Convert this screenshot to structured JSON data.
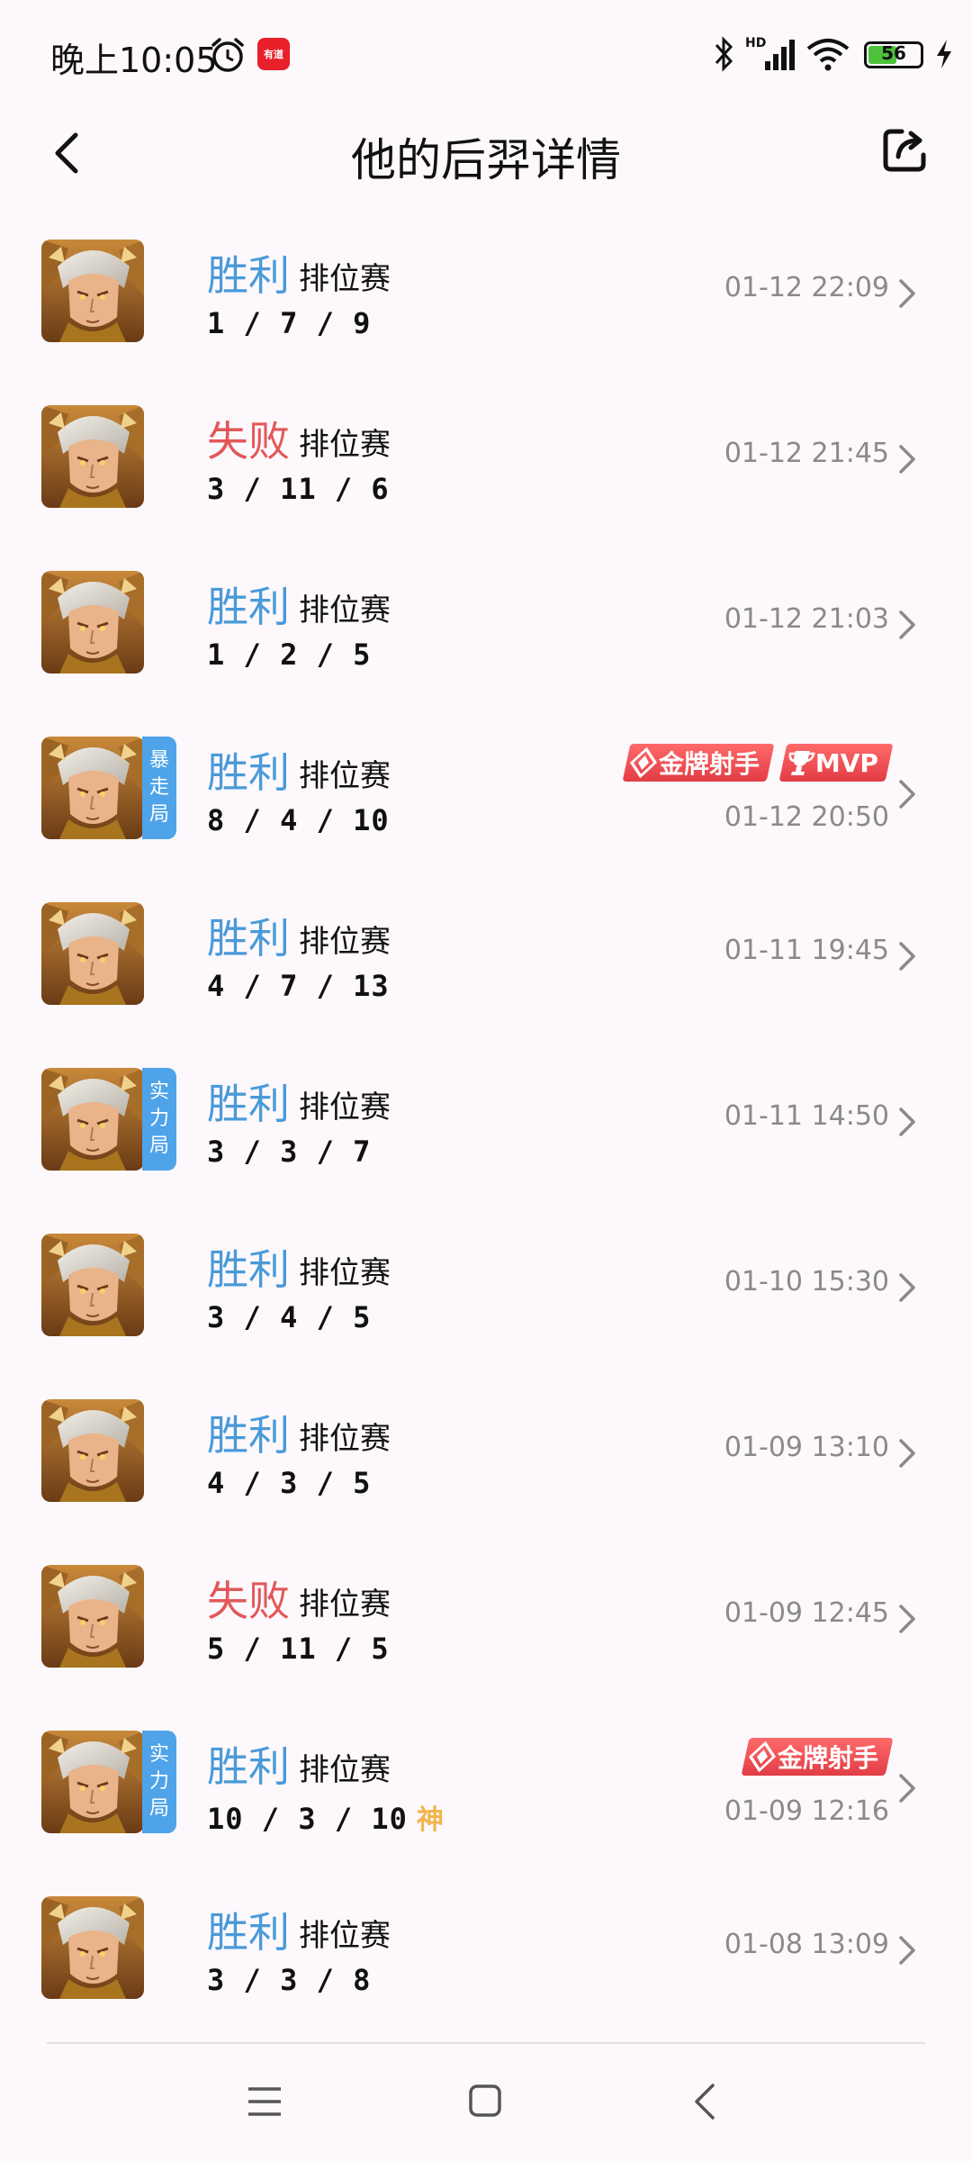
{
  "status_bar": {
    "time": "晚上10:05",
    "app_badge": "有道",
    "network": "HD",
    "battery": "56",
    "battery_percent": 56
  },
  "header": {
    "title": "他的后羿详情"
  },
  "matches": [
    {
      "result": "胜利",
      "outcome": "win",
      "type": "排位赛",
      "kda": "1 / 7 / 9",
      "time": "01-12 22:09"
    },
    {
      "result": "失败",
      "outcome": "lose",
      "type": "排位赛",
      "kda": "3 / 11 / 6",
      "time": "01-12 21:45"
    },
    {
      "result": "胜利",
      "outcome": "win",
      "type": "排位赛",
      "kda": "1 / 2 / 5",
      "time": "01-12 21:03"
    },
    {
      "result": "胜利",
      "outcome": "win",
      "type": "排位赛",
      "kda": "8 / 4 / 10",
      "time": "01-12 20:50",
      "tag": "暴走局",
      "badges": [
        "金牌射手",
        "MVP"
      ]
    },
    {
      "result": "胜利",
      "outcome": "win",
      "type": "排位赛",
      "kda": "4 / 7 / 13",
      "time": "01-11 19:45"
    },
    {
      "result": "胜利",
      "outcome": "win",
      "type": "排位赛",
      "kda": "3 / 3 / 7",
      "time": "01-11 14:50",
      "tag": "实力局"
    },
    {
      "result": "胜利",
      "outcome": "win",
      "type": "排位赛",
      "kda": "3 / 4 / 5",
      "time": "01-10 15:30"
    },
    {
      "result": "胜利",
      "outcome": "win",
      "type": "排位赛",
      "kda": "4 / 3 / 5",
      "time": "01-09 13:10"
    },
    {
      "result": "失败",
      "outcome": "lose",
      "type": "排位赛",
      "kda": "5 / 11 / 5",
      "time": "01-09 12:45"
    },
    {
      "result": "胜利",
      "outcome": "win",
      "type": "排位赛",
      "kda": "10 / 3 / 10",
      "time": "01-09 12:16",
      "tag": "实力局",
      "badges": [
        "金牌射手"
      ],
      "extra": "神"
    },
    {
      "result": "胜利",
      "outcome": "win",
      "type": "排位赛",
      "kda": "3 / 3 / 8",
      "time": "01-08 13:09"
    }
  ],
  "colors": {
    "win": "#4a9ad8",
    "lose": "#e25858",
    "tag_bg": "#4fa3e8",
    "badge": "#e23c45",
    "god": "#f1b54b"
  },
  "icons": {
    "back": "chevron-left-icon",
    "share": "share-icon",
    "row": "chevron-right-icon",
    "nav": [
      "menu-icon",
      "home-icon",
      "back-icon"
    ]
  }
}
